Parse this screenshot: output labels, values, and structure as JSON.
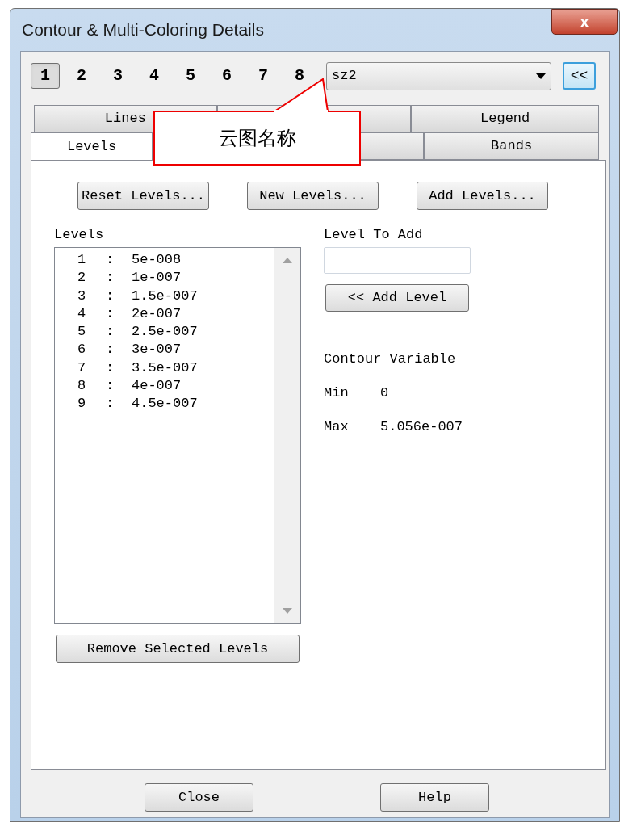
{
  "window": {
    "title": "Contour & Multi-Coloring Details",
    "close": "x"
  },
  "groups": [
    {
      "label": "1",
      "selected": true
    },
    {
      "label": "2",
      "selected": false
    },
    {
      "label": "3",
      "selected": false
    },
    {
      "label": "4",
      "selected": false
    },
    {
      "label": "5",
      "selected": false
    },
    {
      "label": "6",
      "selected": false
    },
    {
      "label": "7",
      "selected": false
    },
    {
      "label": "8",
      "selected": false
    }
  ],
  "name_dropdown": {
    "value": "sz2"
  },
  "collapse_button": "<<",
  "tab_rows": [
    [
      {
        "label": "Lines",
        "selected": false
      },
      {
        "selected": false
      },
      {
        "label": "Legend",
        "selected": false
      }
    ],
    [
      {
        "label": "Levels",
        "selected": true
      },
      {
        "selected": false
      },
      {
        "label": "Bands",
        "selected": false
      }
    ]
  ],
  "callout": {
    "text": "云图名称"
  },
  "action_buttons": [
    "Reset Levels...",
    "New Levels...",
    "Add Levels..."
  ],
  "levels": {
    "label": "Levels",
    "rows": [
      {
        "index": "1",
        "sep": ":",
        "value": "5e-008"
      },
      {
        "index": "2",
        "sep": ":",
        "value": "1e-007"
      },
      {
        "index": "3",
        "sep": ":",
        "value": "1.5e-007"
      },
      {
        "index": "4",
        "sep": ":",
        "value": "2e-007"
      },
      {
        "index": "5",
        "sep": ":",
        "value": "2.5e-007"
      },
      {
        "index": "6",
        "sep": ":",
        "value": "3e-007"
      },
      {
        "index": "7",
        "sep": ":",
        "value": "3.5e-007"
      },
      {
        "index": "8",
        "sep": ":",
        "value": "4e-007"
      },
      {
        "index": "9",
        "sep": ":",
        "value": "4.5e-007"
      }
    ],
    "remove_button": "Remove Selected Levels"
  },
  "level_to_add": {
    "label": "Level To Add",
    "button": "<< Add Level"
  },
  "contour_variable": {
    "title": "Contour Variable",
    "min_label": "Min",
    "min": "0",
    "max_label": "Max",
    "max": "5.056e-007"
  },
  "footer_buttons": [
    "Close",
    "Help"
  ]
}
